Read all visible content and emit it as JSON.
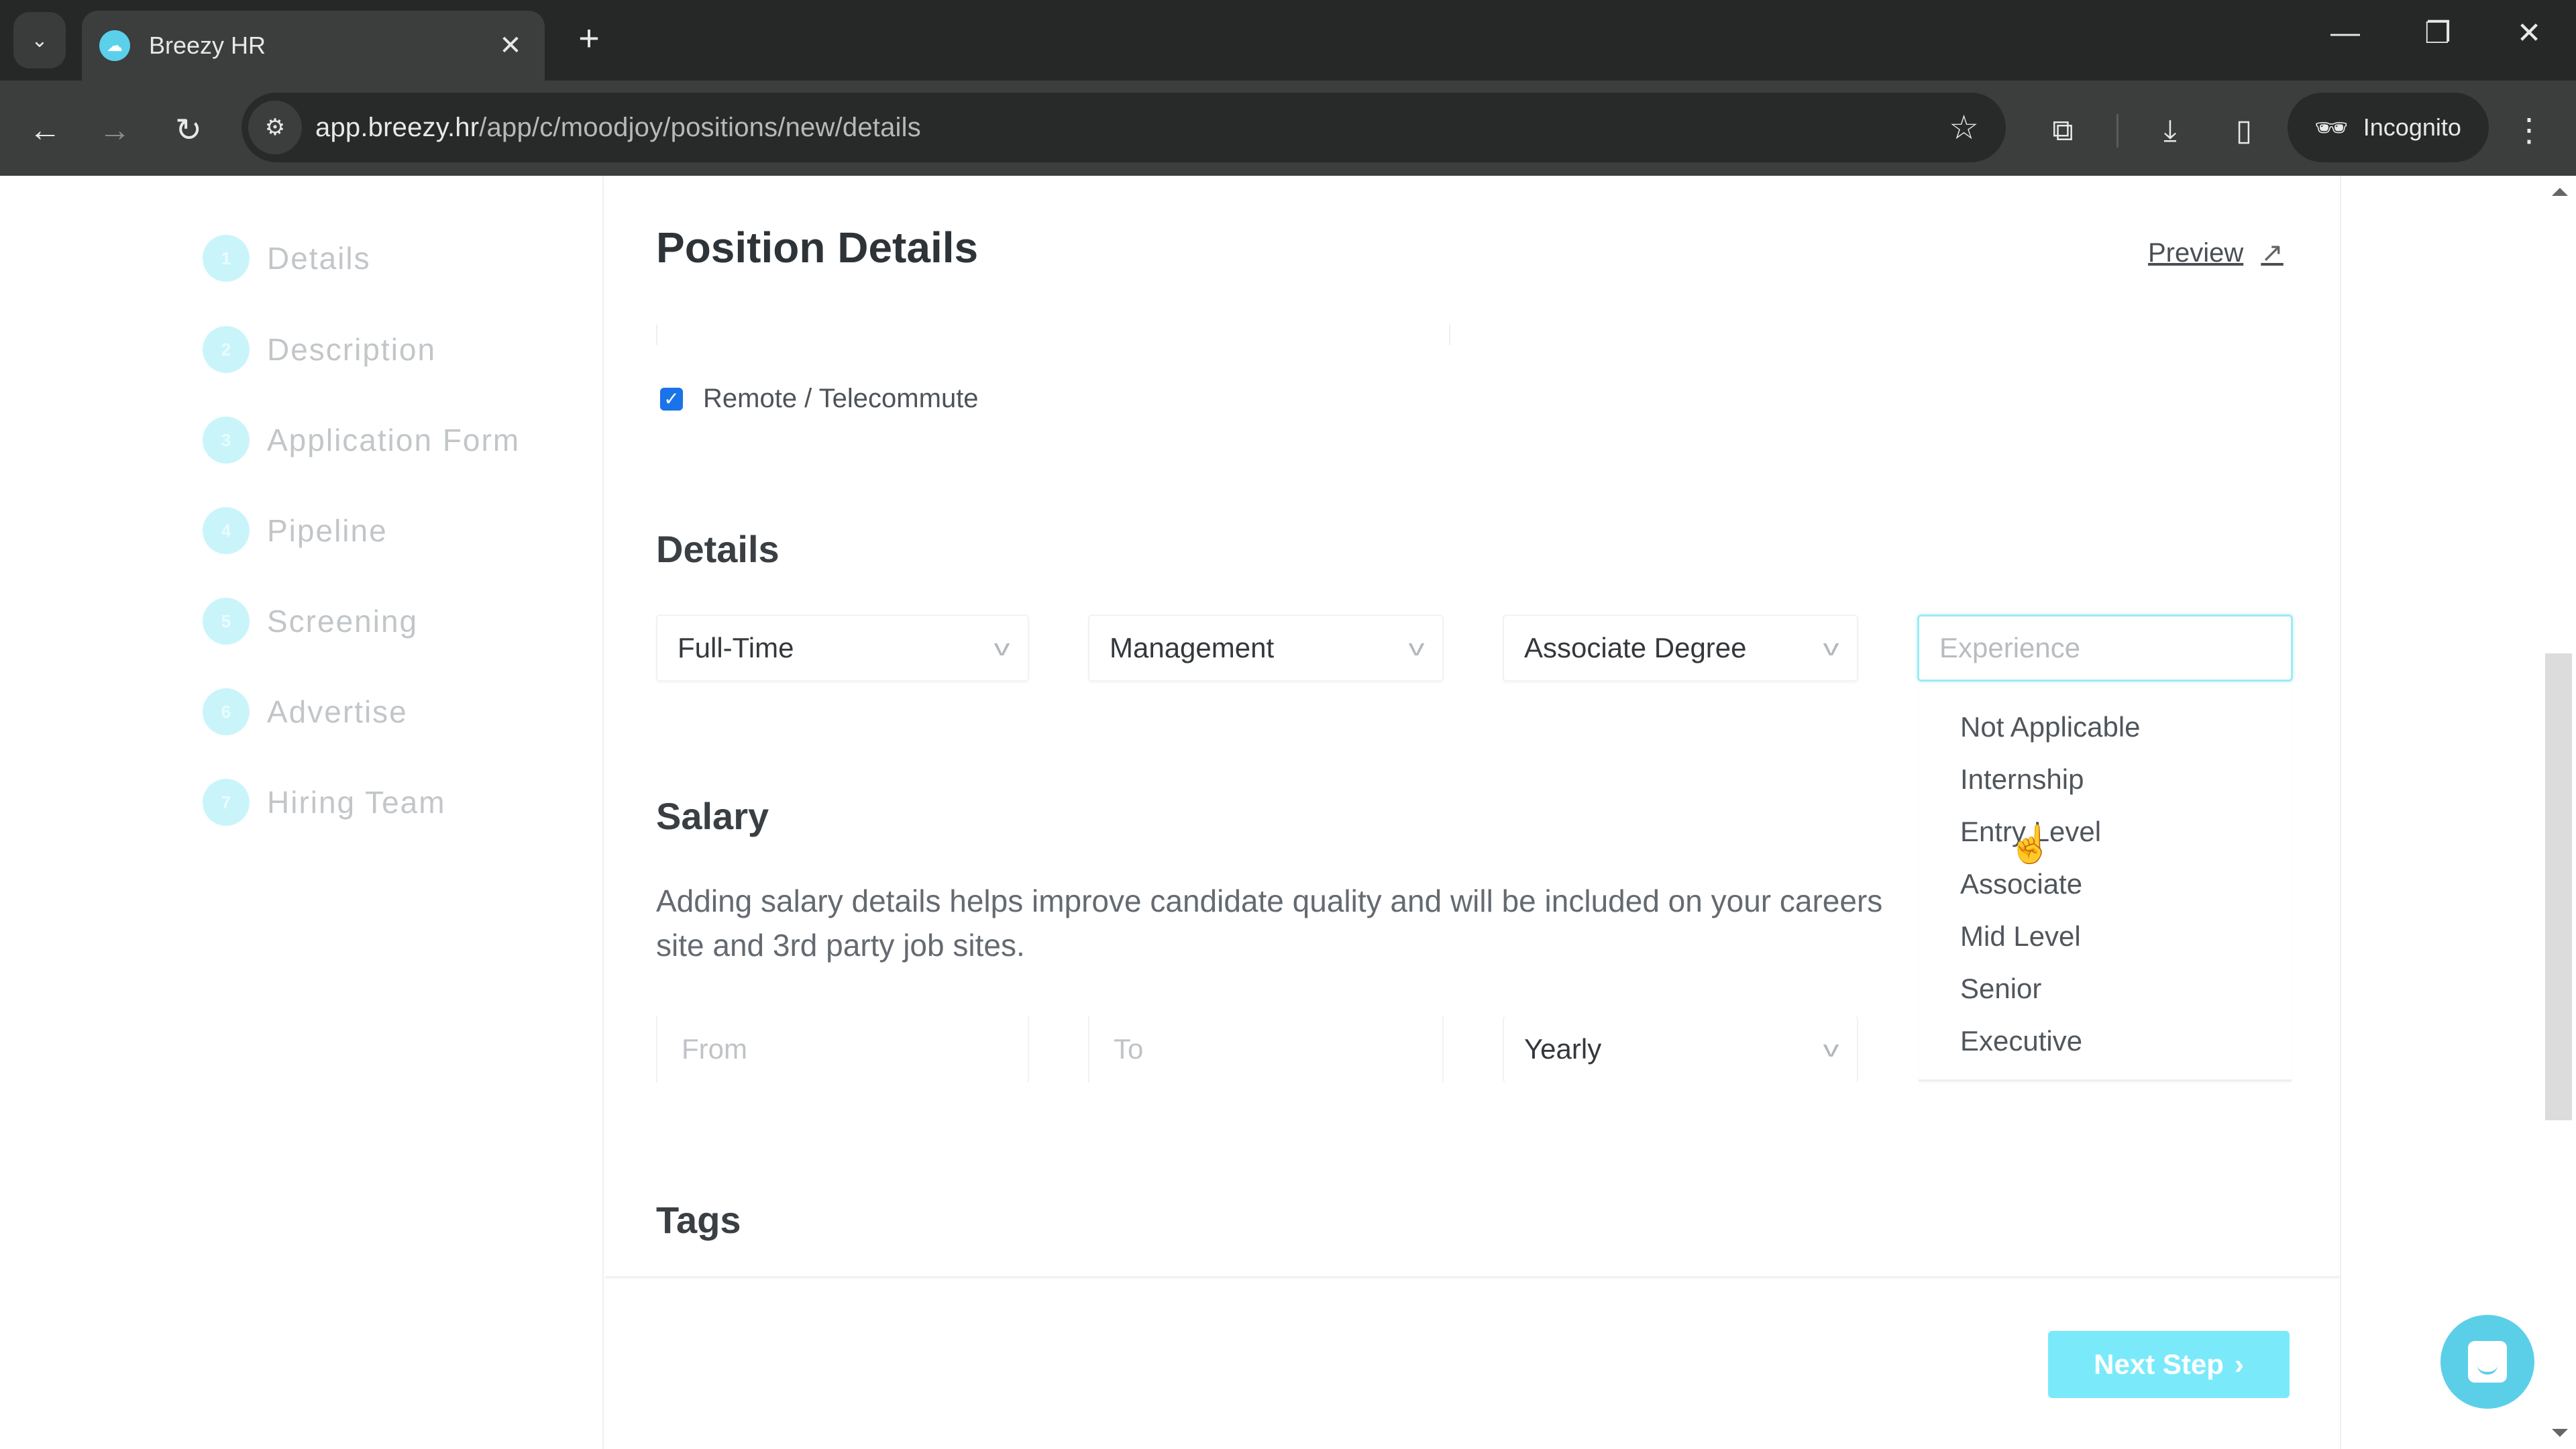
{
  "browser": {
    "tab_title": "Breezy HR",
    "url_host": "app.breezy.hr",
    "url_path": "/app/c/moodjoy/positions/new/details",
    "incognito_label": "Incognito",
    "icons": {
      "tab_menu": "chevron-down-icon",
      "favicon": "breezy-logo-icon",
      "close_tab": "close-icon",
      "new_tab": "plus-icon",
      "back": "arrow-left-icon",
      "forward": "arrow-right-icon",
      "reload": "reload-icon",
      "site_info": "tune-icon",
      "bookmark": "star-icon",
      "extensions": "puzzle-icon",
      "downloads": "download-icon",
      "side_panel": "side-panel-icon",
      "incognito": "incognito-icon",
      "menu": "kebab-menu-icon",
      "minimize": "minimize-icon",
      "restore": "restore-icon",
      "close_window": "close-icon"
    },
    "glyphs": {
      "tab_menu": "⌄",
      "close": "✕",
      "plus": "+",
      "back": "←",
      "forward": "→",
      "reload": "↻",
      "site_info": "⚙",
      "star": "☆",
      "extensions": "⧉",
      "download": "⤓",
      "side_panel": "▯",
      "incognito": "🕶",
      "kebab": "⋮",
      "minimize": "—",
      "restore": "❐"
    }
  },
  "sidebar": {
    "steps": [
      {
        "num": "1",
        "label": "Details"
      },
      {
        "num": "2",
        "label": "Description"
      },
      {
        "num": "3",
        "label": "Application Form"
      },
      {
        "num": "4",
        "label": "Pipeline"
      },
      {
        "num": "5",
        "label": "Screening"
      },
      {
        "num": "6",
        "label": "Advertise"
      },
      {
        "num": "7",
        "label": "Hiring Team"
      }
    ]
  },
  "main": {
    "title": "Position Details",
    "preview_label": "Preview",
    "preview_icon_glyph": "↗",
    "remote_checkbox": {
      "label": "Remote / Telecommute",
      "checked": true,
      "glyph": "✓"
    },
    "details": {
      "title": "Details",
      "employment_type": "Full-Time",
      "category": "Management",
      "education": "Associate Degree",
      "experience_placeholder": "Experience",
      "chevron_glyph": "v",
      "experience_options": [
        "Not Applicable",
        "Internship",
        "Entry Level",
        "Associate",
        "Mid Level",
        "Senior",
        "Executive"
      ]
    },
    "salary": {
      "title": "Salary",
      "description": "Adding salary details helps improve candidate quality and will be included on your careers site and 3rd party job sites.",
      "from_placeholder": "From",
      "to_placeholder": "To",
      "period": "Yearly"
    },
    "tags": {
      "title": "Tags"
    },
    "next_step_label": "Next Step",
    "next_step_glyph": "›"
  },
  "colors": {
    "accent": "#7aeafa",
    "chat": "#5ccfe8",
    "checkbox": "#1a73e8"
  }
}
